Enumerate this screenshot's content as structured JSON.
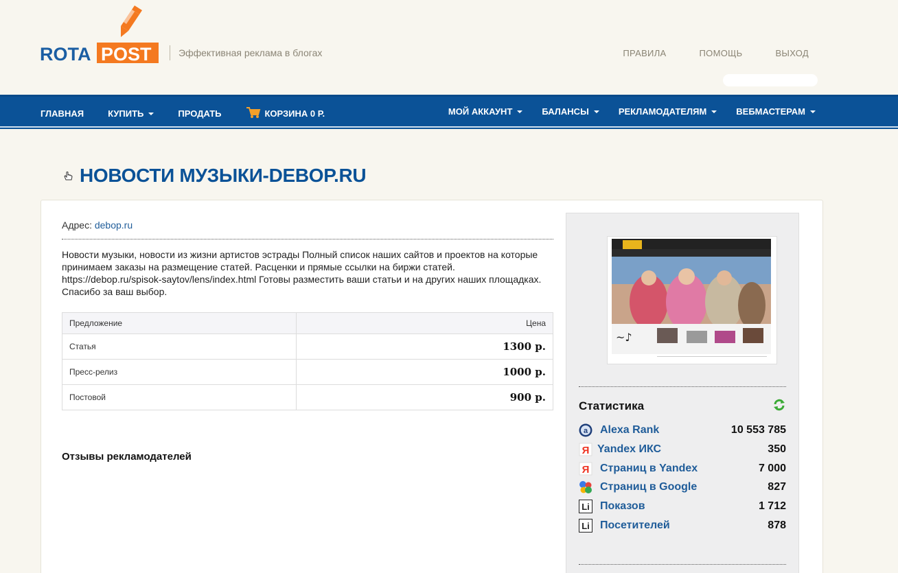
{
  "header": {
    "logo_left": "ROTA",
    "logo_right": "POST",
    "tagline": "Эффективная реклама в блогах",
    "links": [
      "ПРАВИЛА",
      "ПОМОЩЬ",
      "ВЫХОД"
    ]
  },
  "nav": {
    "left": [
      {
        "label": "ГЛАВНАЯ",
        "dropdown": false
      },
      {
        "label": "КУПИТЬ",
        "dropdown": true
      },
      {
        "label": "ПРОДАТЬ",
        "dropdown": false
      },
      {
        "label": "КОРЗИНА 0 Р.",
        "dropdown": false,
        "icon": "cart-icon"
      }
    ],
    "right": [
      {
        "label": "МОЙ АККАУНТ",
        "dropdown": true
      },
      {
        "label": "БАЛАНСЫ",
        "dropdown": true
      },
      {
        "label": "РЕКЛАМОДАТЕЛЯМ",
        "dropdown": true
      },
      {
        "label": "ВЕБМАСТЕРАМ",
        "dropdown": true
      }
    ]
  },
  "page": {
    "title": "НОВОСТИ МУЗЫКИ-DEBOP.RU",
    "address_label": "Адрес:",
    "address_link": "debop.ru",
    "description": "Новости музыки, новости из жизни артистов эстрады Полный список наших сайтов и проектов на которые принимаем заказы на размещение статей. Расценки и прямые ссылки на биржи статей. https://debop.ru/spisok-saytov/lens/index.html Готовы разместить ваши статьи и на других наших площадках. Спасибо за ваш выбор."
  },
  "offers": {
    "headers": [
      "Предложение",
      "Цена"
    ],
    "rows": [
      {
        "name": "Статья",
        "price": "1300 р."
      },
      {
        "name": "Пресс-релиз",
        "price": "1000 р."
      },
      {
        "name": "Постовой",
        "price": "900 р."
      }
    ]
  },
  "reviews": {
    "title": "Отзывы рекламодателей"
  },
  "stats": {
    "title": "Статистика",
    "items": [
      {
        "label": "Alexa Rank",
        "value": "10 553 785",
        "icon": "alexa-icon"
      },
      {
        "label": "Yandex ИКС",
        "value": "350",
        "icon": "yandex-icon"
      },
      {
        "label": "Страниц в Yandex",
        "value": "7 000",
        "icon": "yandex-icon"
      },
      {
        "label": "Страниц в Google",
        "value": "827",
        "icon": "google-icon"
      },
      {
        "label": "Показов",
        "value": "1 712",
        "icon": "liveinternet-icon"
      },
      {
        "label": "Посетителей",
        "value": "878",
        "icon": "liveinternet-icon"
      }
    ]
  },
  "colors": {
    "nav_bg": "#0b5297",
    "accent_orange": "#f47920",
    "logo_blue": "#1b5ea3",
    "link_blue": "#1f5c99"
  }
}
